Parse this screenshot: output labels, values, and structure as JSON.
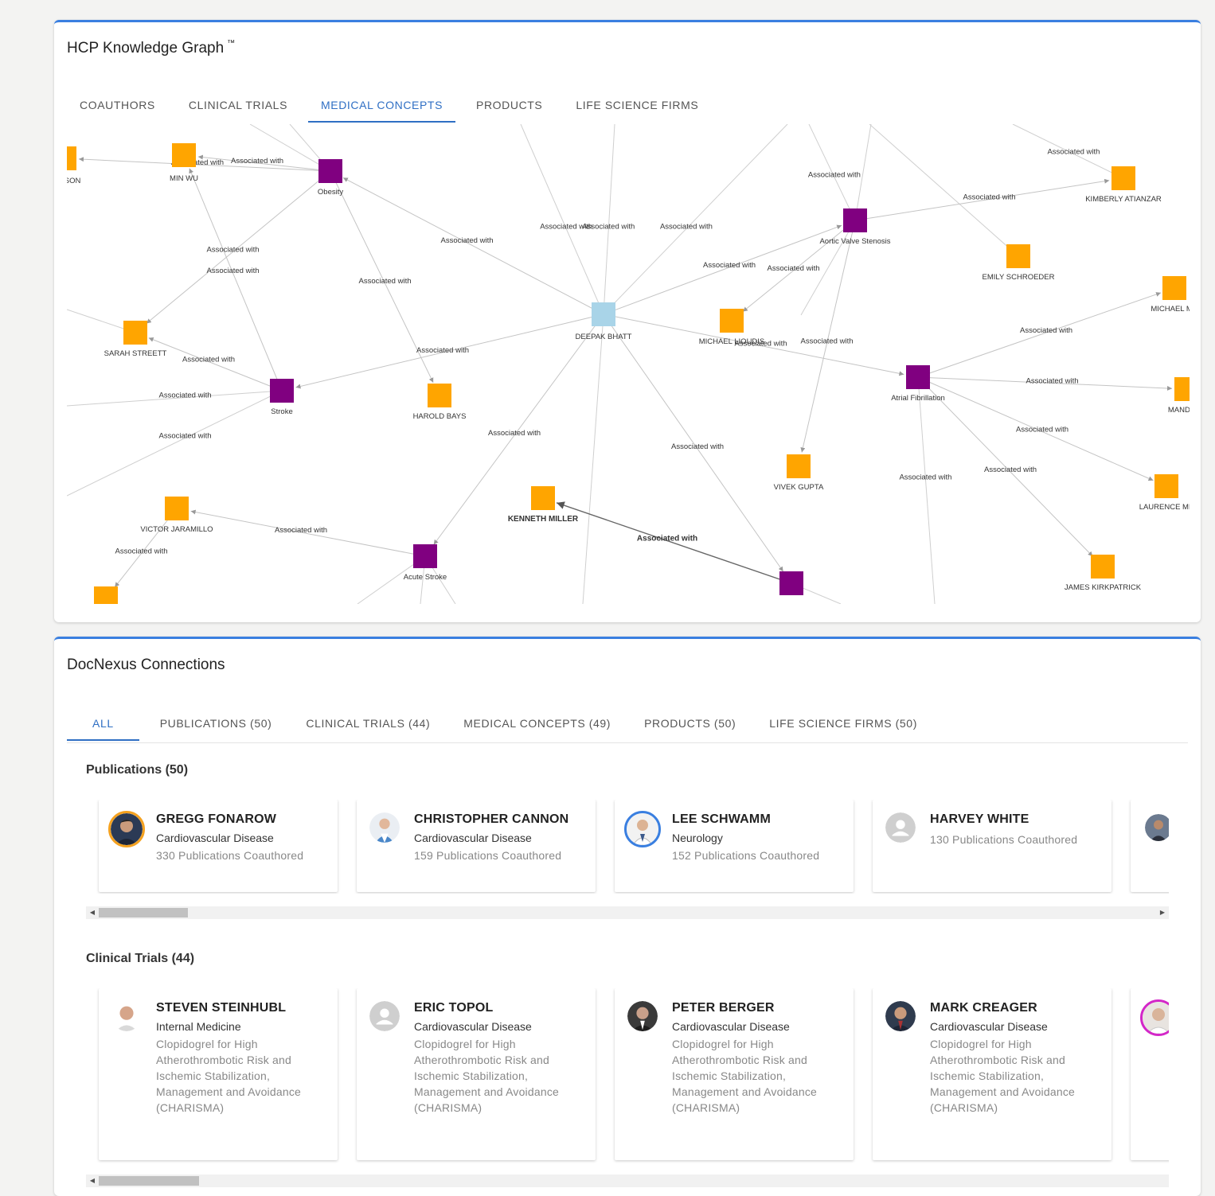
{
  "knowledge_graph": {
    "title": "HCP Knowledge Graph",
    "trademark": "™",
    "tabs": [
      {
        "label": "COAUTHORS",
        "active": false
      },
      {
        "label": "CLINICAL TRIALS",
        "active": false
      },
      {
        "label": "MEDICAL CONCEPTS",
        "active": true
      },
      {
        "label": "PRODUCTS",
        "active": false
      },
      {
        "label": "LIFE SCIENCE FIRMS",
        "active": false
      }
    ],
    "edge_label": "Associated with",
    "colors": {
      "center": "#a9d4e8",
      "concept": "#800080",
      "person": "#ffa500"
    },
    "nodes": [
      {
        "id": "deepak",
        "label": "DEEPAK BHATT",
        "type": "center"
      },
      {
        "id": "obesity",
        "label": "Obesity",
        "type": "concept"
      },
      {
        "id": "stroke",
        "label": "Stroke",
        "type": "concept"
      },
      {
        "id": "acute",
        "label": "Acute Stroke",
        "type": "concept"
      },
      {
        "id": "aortic",
        "label": "Aortic Valve Stenosis",
        "type": "concept"
      },
      {
        "id": "afib",
        "label": "Atrial Fibrillation",
        "type": "concept"
      },
      {
        "id": "bottom",
        "label": "",
        "type": "concept"
      },
      {
        "id": "minwu",
        "label": "MIN WU",
        "type": "person"
      },
      {
        "id": "derson",
        "label": "DERSON",
        "type": "person"
      },
      {
        "id": "sarah",
        "label": "SARAH STREETT",
        "type": "person"
      },
      {
        "id": "harold",
        "label": "HAROLD BAYS",
        "type": "person"
      },
      {
        "id": "victor",
        "label": "VICTOR JARAMILLO",
        "type": "person"
      },
      {
        "id": "bl",
        "label": "",
        "type": "person"
      },
      {
        "id": "kenneth",
        "label": "KENNETH MILLER",
        "type": "person",
        "bold": true
      },
      {
        "id": "michaell",
        "label": "MICHAEL LIOUDIS",
        "type": "person"
      },
      {
        "id": "vivek",
        "label": "VIVEK GUPTA",
        "type": "person"
      },
      {
        "id": "kimberly",
        "label": "KIMBERLY ATIANZAR",
        "type": "person"
      },
      {
        "id": "emily",
        "label": "EMILY SCHROEDER",
        "type": "person"
      },
      {
        "id": "michaelm",
        "label": "MICHAEL MU",
        "type": "person"
      },
      {
        "id": "mandip",
        "label": "MANDIP D",
        "type": "person"
      },
      {
        "id": "laurence",
        "label": "LAURENCE ME",
        "type": "person"
      },
      {
        "id": "james",
        "label": "JAMES KIRKPATRICK",
        "type": "person"
      }
    ],
    "edges": [
      [
        "deepak",
        "obesity"
      ],
      [
        "deepak",
        "stroke"
      ],
      [
        "deepak",
        "acute"
      ],
      [
        "deepak",
        "aortic"
      ],
      [
        "deepak",
        "afib"
      ],
      [
        "deepak",
        "bottom"
      ],
      [
        "obesity",
        "minwu"
      ],
      [
        "obesity",
        "derson"
      ],
      [
        "obesity",
        "sarah"
      ],
      [
        "obesity",
        "harold"
      ],
      [
        "stroke",
        "minwu"
      ],
      [
        "stroke",
        "sarah"
      ],
      [
        "acute",
        "victor"
      ],
      [
        "victor",
        "bl"
      ],
      [
        "bottom",
        "kenneth",
        "bold"
      ],
      [
        "aortic",
        "kimberly"
      ],
      [
        "aortic",
        "michaell"
      ],
      [
        "aortic",
        "vivek"
      ],
      [
        "afib",
        "michaelm"
      ],
      [
        "afib",
        "mandip"
      ],
      [
        "afib",
        "laurence"
      ],
      [
        "afib",
        "james"
      ]
    ]
  },
  "docnexus": {
    "title": "DocNexus Connections",
    "tabs": [
      {
        "label": "ALL",
        "active": true
      },
      {
        "label": "PUBLICATIONS (50)",
        "active": false
      },
      {
        "label": "CLINICAL TRIALS (44)",
        "active": false
      },
      {
        "label": "MEDICAL CONCEPTS (49)",
        "active": false
      },
      {
        "label": "PRODUCTS (50)",
        "active": false
      },
      {
        "label": "LIFE SCIENCE FIRMS (50)",
        "active": false
      }
    ],
    "publications": {
      "title": "Publications (50)",
      "cards": [
        {
          "name": "GREGG FONAROW",
          "specialty": "Cardiovascular Disease",
          "detail": "330 Publications Coauthored",
          "avatar": "ring-orange"
        },
        {
          "name": "CHRISTOPHER CANNON",
          "specialty": "Cardiovascular Disease",
          "detail": "159 Publications Coauthored",
          "avatar": "plain"
        },
        {
          "name": "LEE SCHWAMM",
          "specialty": "Neurology",
          "detail": "152 Publications Coauthored",
          "avatar": "ring-blue"
        },
        {
          "name": "HARVEY WHITE",
          "specialty": "",
          "detail": "130 Publications Coauthored",
          "avatar": "placeholder"
        },
        {
          "name": "",
          "specialty": "",
          "detail": "",
          "avatar": "plain"
        }
      ]
    },
    "clinical_trials": {
      "title": "Clinical Trials (44)",
      "cards": [
        {
          "name": "STEVEN STEINHUBL",
          "specialty": "Internal Medicine",
          "detail": "Clopidogrel for High Atherothrombotic Risk and Ischemic Stabilization, Management and Avoidance (CHARISMA)",
          "avatar": "plain"
        },
        {
          "name": "ERIC TOPOL",
          "specialty": "Cardiovascular Disease",
          "detail": "Clopidogrel for High Atherothrombotic Risk and Ischemic Stabilization, Management and Avoidance (CHARISMA)",
          "avatar": "placeholder"
        },
        {
          "name": "PETER BERGER",
          "specialty": "Cardiovascular Disease",
          "detail": "Clopidogrel for High Atherothrombotic Risk and Ischemic Stabilization, Management and Avoidance (CHARISMA)",
          "avatar": "plain"
        },
        {
          "name": "MARK CREAGER",
          "specialty": "Cardiovascular Disease",
          "detail": "Clopidogrel for High Atherothrombotic Risk and Ischemic Stabilization, Management and Avoidance (CHARISMA)",
          "avatar": "plain"
        },
        {
          "name": "",
          "specialty": "",
          "detail": "",
          "avatar": "ring-magenta"
        }
      ]
    },
    "scrollbar_arrows": {
      "left": "◀",
      "right": "▶"
    }
  }
}
